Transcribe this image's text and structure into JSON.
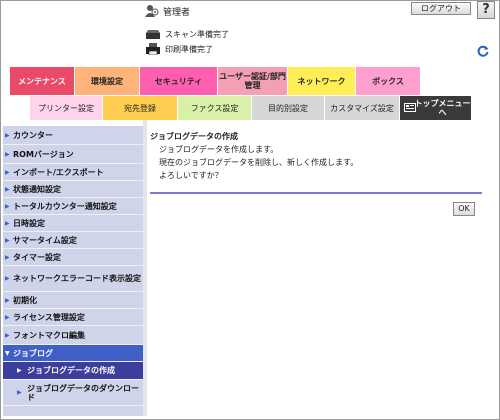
{
  "header": {
    "user_label": "管理者",
    "logout_label": "ログアウト",
    "help_label": "?",
    "scan_status": "スキャン準備完了",
    "print_status": "印刷準備完了"
  },
  "main_tabs": [
    {
      "label": "メンテナンス",
      "color": "#e94a6a",
      "active": true
    },
    {
      "label": "環境設定",
      "color": "#ffb27a"
    },
    {
      "label": "セキュリティ",
      "color": "#ff5fae"
    },
    {
      "label": "ユーザー認証/部門管理",
      "color": "#f4a0b4"
    },
    {
      "label": "ネットワーク",
      "color": "#ffee55"
    },
    {
      "label": "ボックス",
      "color": "#ff9fd0"
    }
  ],
  "sub_tabs": [
    {
      "label": "プリンター設定",
      "color": "#ffd3ec"
    },
    {
      "label": "宛先登録",
      "color": "#ffce50"
    },
    {
      "label": "ファクス設定",
      "color": "#d8f0a8"
    },
    {
      "label": "目的別設定",
      "color": "#d6d6d6"
    },
    {
      "label": "カスタマイズ設定",
      "color": "#d6d6d6"
    },
    {
      "label": "トップメニューへ",
      "color": "#3a3a3a"
    }
  ],
  "sidebar": {
    "items": [
      {
        "label": "カウンター"
      },
      {
        "label": "ROMバージョン"
      },
      {
        "label": "インポート/エクスポート"
      },
      {
        "label": "状態通知設定"
      },
      {
        "label": "トータルカウンター通知設定"
      },
      {
        "label": "日時設定"
      },
      {
        "label": "サマータイム設定"
      },
      {
        "label": "タイマー設定"
      },
      {
        "label": "ネットワークエラーコード表示設定"
      },
      {
        "label": "初期化"
      },
      {
        "label": "ライセンス管理設定"
      },
      {
        "label": "フォントマクロ編集"
      },
      {
        "label": "ジョブログ"
      },
      {
        "label": "ジョブログデータの作成"
      },
      {
        "label": "ジョブログデータのダウンロード"
      }
    ]
  },
  "content": {
    "title": "ジョブログデータの作成",
    "lines": [
      "ジョブログデータを作成します。",
      "現在のジョブログデータを削除し、新しく作成します。",
      "よろしいですか？"
    ],
    "ok_label": "OK"
  }
}
